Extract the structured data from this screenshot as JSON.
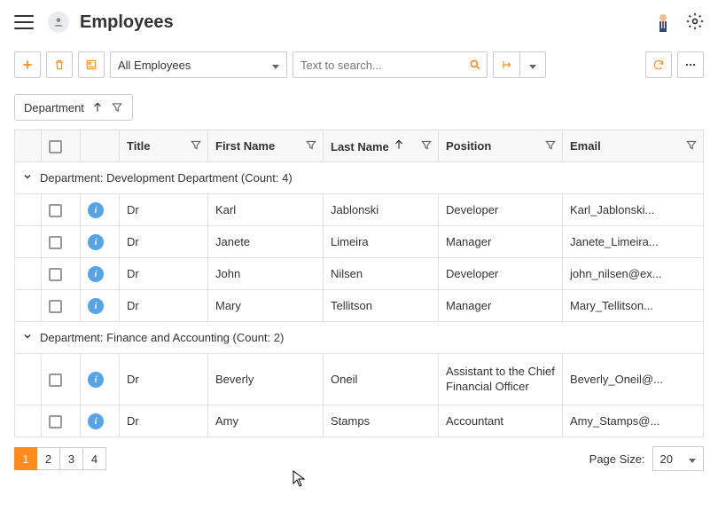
{
  "header": {
    "title": "Employees"
  },
  "toolbar": {
    "filter_dropdown": "All Employees",
    "search_placeholder": "Text to search..."
  },
  "group_chip": {
    "label": "Department"
  },
  "columns": {
    "title": "Title",
    "first_name": "First Name",
    "last_name": "Last Name",
    "position": "Position",
    "email": "Email"
  },
  "groups": [
    {
      "label": "Department: Development Department (Count: 4)",
      "rows": [
        {
          "title": "Dr",
          "first": "Karl",
          "last": "Jablonski",
          "position": "Developer",
          "email": "Karl_Jablonski..."
        },
        {
          "title": "Dr",
          "first": "Janete",
          "last": "Limeira",
          "position": "Manager",
          "email": "Janete_Limeira..."
        },
        {
          "title": "Dr",
          "first": "John",
          "last": "Nilsen",
          "position": "Developer",
          "email": "john_nilsen@ex..."
        },
        {
          "title": "Dr",
          "first": "Mary",
          "last": "Tellitson",
          "position": "Manager",
          "email": "Mary_Tellitson..."
        }
      ]
    },
    {
      "label": "Department: Finance and Accounting (Count: 2)",
      "rows": [
        {
          "title": "Dr",
          "first": "Beverly",
          "last": "Oneil",
          "position": "Assistant to the Chief Financial Officer",
          "email": "Beverly_Oneil@..."
        },
        {
          "title": "Dr",
          "first": "Amy",
          "last": "Stamps",
          "position": "Accountant",
          "email": "Amy_Stamps@..."
        }
      ]
    }
  ],
  "pager": {
    "pages": [
      "1",
      "2",
      "3",
      "4"
    ],
    "active": 0,
    "size_label": "Page Size:",
    "size_value": "20"
  },
  "icons": {
    "plus": "plus-icon",
    "trash": "trash-icon",
    "card": "card-icon",
    "search": "search-icon",
    "export": "export-icon",
    "refresh": "refresh-icon",
    "dots": "dots-icon",
    "gear": "gear-icon",
    "filter": "filter-icon",
    "arrow_up": "arrow-up-icon",
    "chevron": "chevron-down-icon",
    "info": "i"
  }
}
